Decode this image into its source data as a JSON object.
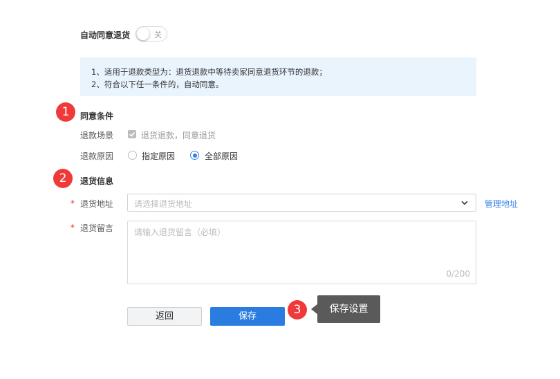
{
  "auto_agree": {
    "title": "自动同意退货",
    "toggle_text": "关",
    "enabled": false
  },
  "notice": {
    "lines": [
      "1、适用于退款类型为：退货退款中等待卖家同意退货环节的退款；",
      "2、符合以下任一条件的，自动同意。"
    ]
  },
  "steps": [
    "1",
    "2",
    "3"
  ],
  "conditions": {
    "section_title": "同意条件",
    "scene_label": "退款场景",
    "scene_option": "退货退款，同意退货",
    "scene_checked": true,
    "reason_label": "退款原因",
    "reason_options": [
      "指定原因",
      "全部原因"
    ],
    "reason_selected": "全部原因"
  },
  "return_info": {
    "section_title": "退货信息",
    "required_mark": "*",
    "address_label": "退货地址",
    "address_placeholder": "请选择退货地址",
    "manage_link": "管理地址",
    "message_label": "退货留言",
    "message_placeholder": "请输入退货留言（必填）",
    "counter": "0/200"
  },
  "actions": {
    "back_label": "返回",
    "save_label": "保存"
  },
  "tooltip": {
    "text": "保存设置"
  },
  "colors": {
    "accent": "#2b7ce0",
    "step_badge": "#f03a3a",
    "notice_bg": "#eaf4fd",
    "tooltip_bg": "#5a5a5a"
  }
}
